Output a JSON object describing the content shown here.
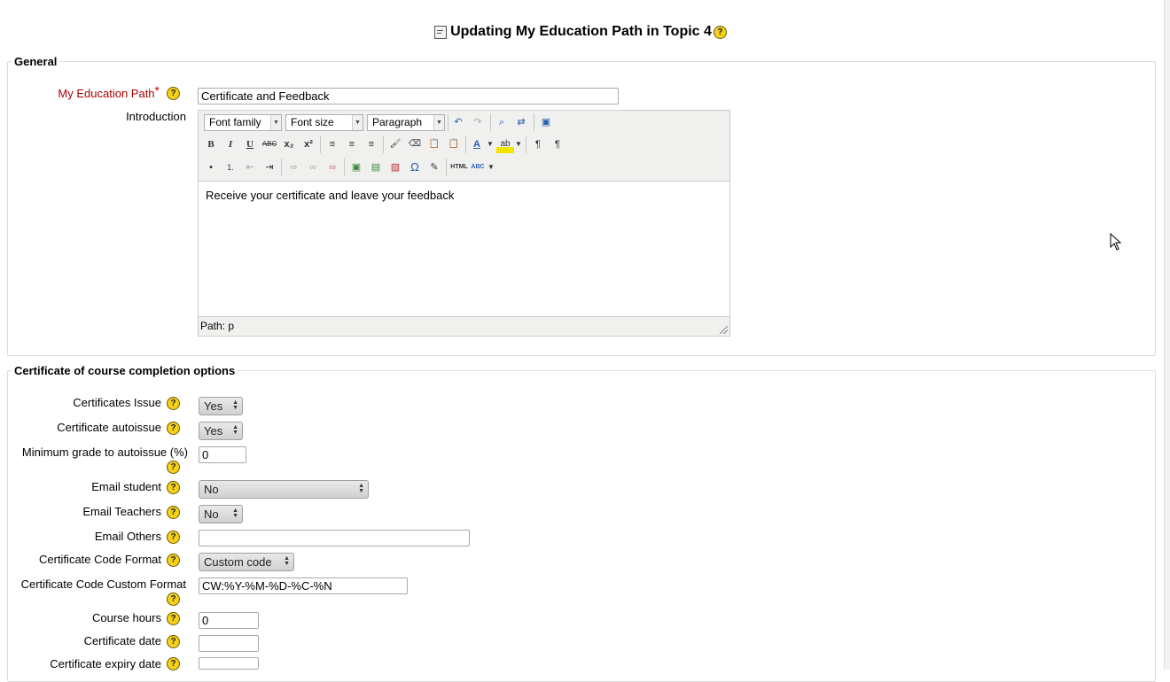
{
  "page": {
    "title": "Updating My Education Path in Topic 4"
  },
  "general": {
    "legend": "General",
    "name_label": "My Education Path",
    "name_required": "*",
    "name_value": "Certificate and Feedback",
    "intro_label": "Introduction",
    "editor": {
      "font_family": "Font family",
      "font_size": "Font size",
      "format": "Paragraph",
      "content": "Receive your certificate and leave your feedback",
      "path": "Path: p",
      "tools_row2": [
        "B",
        "I",
        "U",
        "ABC",
        "x₂",
        "x²",
        "≡",
        "≡",
        "≡",
        "🖌",
        "⌫",
        "📋",
        "📋",
        "A",
        "ab",
        "¶",
        "¶"
      ],
      "tools_row3": [
        "•",
        "1.",
        "⇤",
        "⇥",
        "∞",
        "∞",
        "∞",
        "▣",
        "▤",
        "▧",
        "Ω",
        "✎",
        "HTML",
        "ABC"
      ]
    }
  },
  "cert": {
    "legend": "Certificate of course completion options",
    "issue_label": "Certificates Issue",
    "issue_value": "Yes",
    "autoissue_label": "Certificate autoissue",
    "autoissue_value": "Yes",
    "mingrade_label": "Minimum grade to autoissue (%)",
    "mingrade_value": "0",
    "email_student_label": "Email student",
    "email_student_value": "No",
    "email_teachers_label": "Email Teachers",
    "email_teachers_value": "No",
    "email_others_label": "Email Others",
    "email_others_value": "",
    "code_format_label": "Certificate Code Format",
    "code_format_value": "Custom code",
    "code_custom_label": "Certificate Code Custom Format",
    "code_custom_value": "CW:%Y-%M-%D-%C-%N",
    "hours_label": "Course hours",
    "hours_value": "0",
    "date_label": "Certificate date",
    "date_value": "",
    "expiry_label": "Certificate expiry date",
    "expiry_value": ""
  },
  "help_glyph": "?",
  "icons": {
    "help": "help-icon",
    "doc": "document-icon"
  }
}
